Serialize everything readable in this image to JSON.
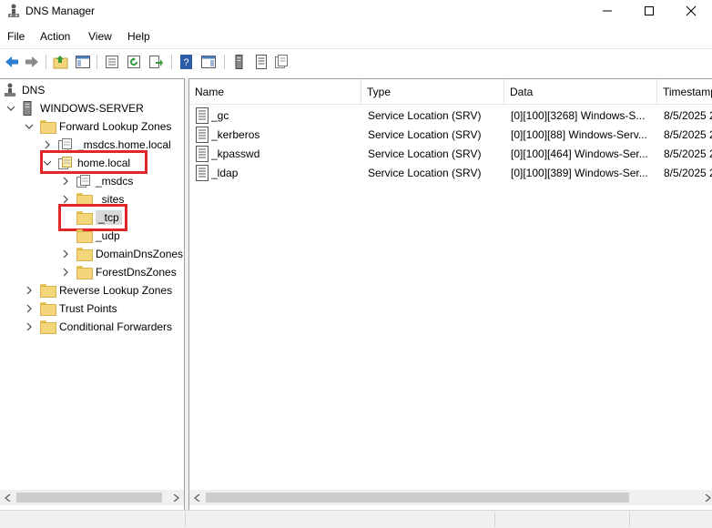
{
  "window": {
    "title": "DNS Manager",
    "icon": "dns-manager-icon"
  },
  "menu": [
    "File",
    "Action",
    "View",
    "Help"
  ],
  "toolbar": {
    "icons": [
      "back-icon",
      "forward-icon",
      "up-folder-icon",
      "show-hide-tree-icon",
      "properties-icon",
      "refresh-icon",
      "export-list-icon",
      "help-icon",
      "show-action-pane-icon",
      "server-icon",
      "record-icon",
      "zone-icon"
    ]
  },
  "tree": {
    "dns": "DNS",
    "server": "WINDOWS-SERVER",
    "forward_zones": "Forward Lookup Zones",
    "msdcs_zone": "_msdcs.home.local",
    "home_local": "home.local",
    "msdcs": "_msdcs",
    "sites": "_sites",
    "tcp": "_tcp",
    "udp": "_udp",
    "domain_dns_zones": "DomainDnsZones",
    "forest_dns_zones": "ForestDnsZones",
    "reverse_zones": "Reverse Lookup Zones",
    "trust_points": "Trust Points",
    "conditional_forwarders": "Conditional Forwarders"
  },
  "list": {
    "columns": [
      "Name",
      "Type",
      "Data",
      "Timestamp"
    ],
    "rows": [
      {
        "name": "_gc",
        "type": "Service Location (SRV)",
        "data": "[0][100][3268] Windows-S...",
        "timestamp": "8/5/2025 2"
      },
      {
        "name": "_kerberos",
        "type": "Service Location (SRV)",
        "data": "[0][100][88] Windows-Serv...",
        "timestamp": "8/5/2025 2"
      },
      {
        "name": "_kpasswd",
        "type": "Service Location (SRV)",
        "data": "[0][100][464] Windows-Ser...",
        "timestamp": "8/5/2025 2"
      },
      {
        "name": "_ldap",
        "type": "Service Location (SRV)",
        "data": "[0][100][389] Windows-Ser...",
        "timestamp": "8/5/2025 2"
      }
    ]
  },
  "highlight_color": "#e0282b"
}
